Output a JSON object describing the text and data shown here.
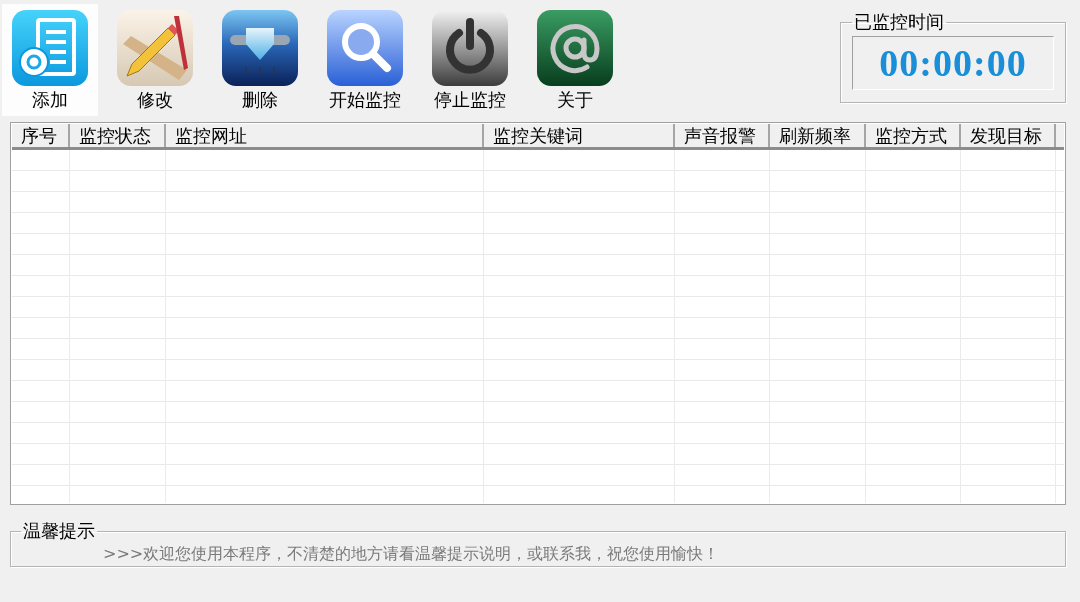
{
  "toolbar": [
    {
      "kind": "list",
      "label": "添加",
      "selected": true
    },
    {
      "kind": "edit",
      "label": "修改",
      "selected": false
    },
    {
      "kind": "pin",
      "label": "删除",
      "selected": false
    },
    {
      "kind": "search",
      "label": "开始监控",
      "selected": false
    },
    {
      "kind": "power",
      "label": "停止监控",
      "selected": false
    },
    {
      "kind": "at",
      "label": "关于",
      "selected": false
    }
  ],
  "timer": {
    "title": "已监控时间",
    "value": "00:00:00"
  },
  "table": {
    "columns": [
      "序号",
      "监控状态",
      "监控网址",
      "监控关键词",
      "声音报警",
      "刷新频率",
      "监控方式",
      "发现目标"
    ]
  },
  "tips": {
    "title": "温馨提示",
    "message": ">>>欢迎您使用本程序，不清楚的地方请看温馨提示说明，或联系我，祝您使用愉快！"
  }
}
